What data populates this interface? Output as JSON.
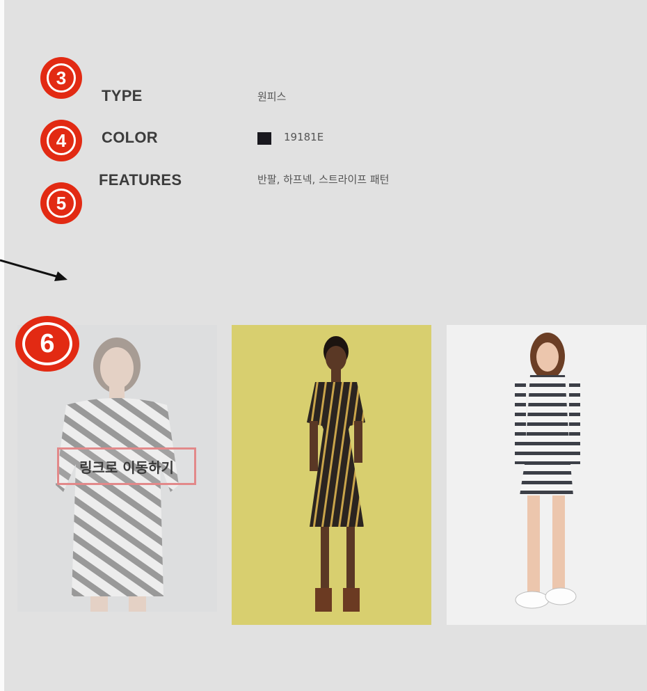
{
  "badges": {
    "b3": "3",
    "b4": "4",
    "b5": "5",
    "b6": "6"
  },
  "attributes": {
    "type": {
      "label": "TYPE",
      "value": "원피스"
    },
    "color": {
      "label": "COLOR",
      "value": "19181E",
      "swatch": "#19181e"
    },
    "features": {
      "label": "FEATURES",
      "value": "반팔, 하프넥, 스트라이프 패턴"
    }
  },
  "gallery": {
    "link_label": "링크로 이동하기"
  },
  "colors": {
    "background": "#e1e1e1",
    "badge": "#e22a13",
    "link_border": "#e2898a"
  }
}
